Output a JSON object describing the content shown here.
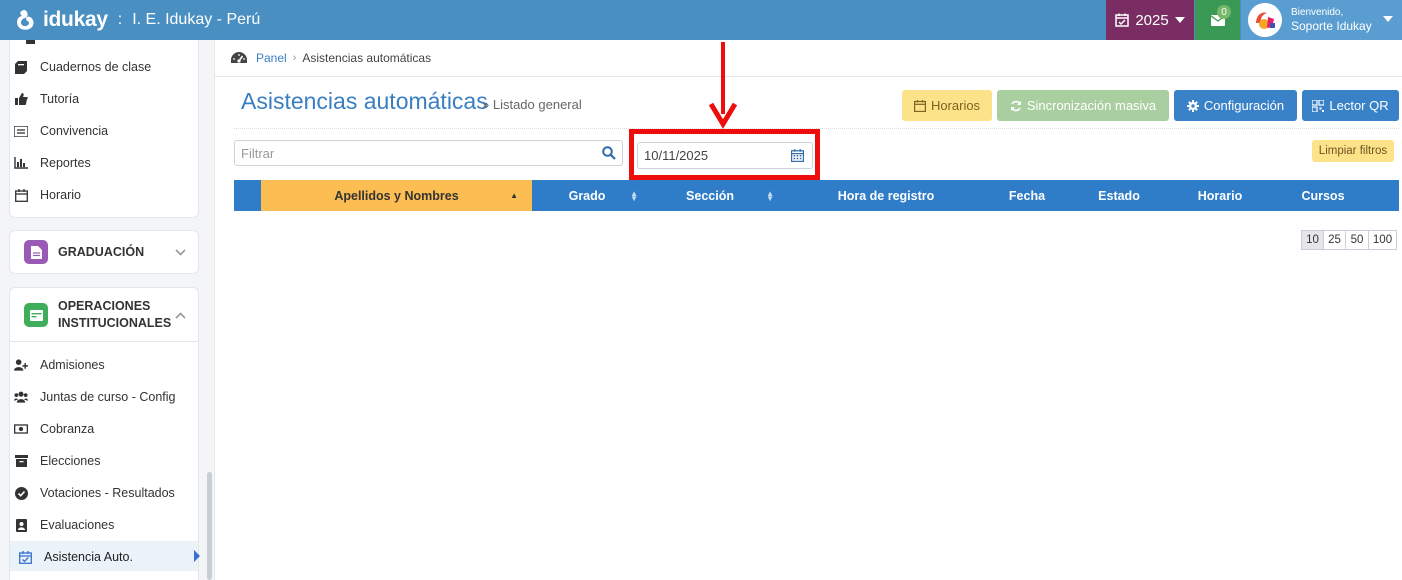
{
  "topbar": {
    "logo_text": "idukay",
    "separator": ":",
    "school": "I. E. Idukay - Perú",
    "year": "2025",
    "mail_count": "0",
    "greeting": "Bienvenido,",
    "user_name": "Soporte Idukay",
    "colors": {
      "bar": "#4a8fc2",
      "year": "#7a2d63",
      "mail": "#3a9a55",
      "user": "#5a9dd0"
    }
  },
  "sidebar": {
    "top_items": [
      {
        "label": "Cuadernos de clase",
        "icon": "notebook-icon"
      },
      {
        "label": "Tutoría",
        "icon": "thumbs-up-icon"
      },
      {
        "label": "Convivencia",
        "icon": "list-icon"
      },
      {
        "label": "Reportes",
        "icon": "bar-chart-icon"
      },
      {
        "label": "Horario",
        "icon": "calendar-icon"
      }
    ],
    "graduacion": "GRADUACIÓN",
    "operaciones_line1": "OPERACIONES",
    "operaciones_line2": "INSTITUCIONALES",
    "ops_items": [
      {
        "label": "Admisiones",
        "icon": "user-plus-icon"
      },
      {
        "label": "Juntas de curso - Config",
        "icon": "users-icon"
      },
      {
        "label": "Cobranza",
        "icon": "money-icon"
      },
      {
        "label": "Elecciones",
        "icon": "archive-icon"
      },
      {
        "label": "Votaciones - Resultados",
        "icon": "check-circle-icon"
      },
      {
        "label": "Evaluaciones",
        "icon": "contact-card-icon"
      },
      {
        "label": "Asistencia Auto.",
        "icon": "calendar-check-icon"
      }
    ]
  },
  "breadcrumb": {
    "home": "Panel",
    "current": "Asistencias automáticas"
  },
  "page": {
    "title": "Asistencias automáticas",
    "subtitle": "» Listado general",
    "buttons": {
      "horarios": "Horarios",
      "sync": "Sincronización masiva",
      "config": "Configuración",
      "qr": "Lector QR"
    },
    "filter_placeholder": "Filtrar",
    "date_value": "10/11/2025",
    "clear_filters": "Limpiar filtros"
  },
  "table": {
    "columns": [
      "Apellidos y Nombres",
      "Grado",
      "Sección",
      "Hora de registro",
      "Fecha",
      "Estado",
      "Horario",
      "Cursos"
    ],
    "page_sizes": [
      "10",
      "25",
      "50",
      "100"
    ],
    "selected_page_size": "10"
  }
}
